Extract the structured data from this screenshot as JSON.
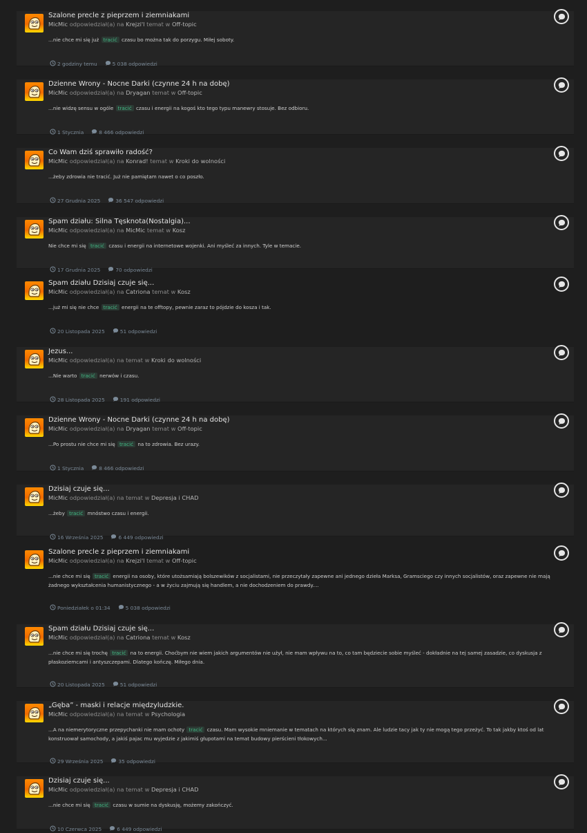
{
  "results": [
    {
      "title": "Szalone precle z pieprzem i ziemniakami",
      "author": "MicMic",
      "action": "odpowiedział(a) na",
      "topic_author": "Krejzi'l",
      "forum": "Off-topic",
      "snippet_before": "...nie chce mi się już",
      "highlight": "tracić",
      "snippet_after": "czasu bo można tak do porzygu. Miłej soboty.",
      "date": "2 godziny temu",
      "replies": "5 038 odpowiedzi"
    },
    {
      "title": "Dzienne Wrony - Nocne Darki (czynne 24 h na dobę)",
      "author": "MicMic",
      "action": "odpowiedział(a) na",
      "topic_author": "Dryagan",
      "forum": "Off-topic",
      "snippet_before": "...nie widzę sensu w ogóle",
      "highlight": "tracić",
      "snippet_after": "czasu i energii na kogoś kto tego typu manewry stosuje. Bez odbioru.",
      "date": "1 Stycznia",
      "replies": "8 466 odpowiedzi"
    },
    {
      "title": "Co Wam dziś sprawiło radość?",
      "author": "MicMic",
      "action": "odpowiedział(a) na",
      "topic_author": "Konrad!",
      "forum": "Kroki do wolności",
      "snippet_before": "...żeby zdrowia nie tracić. Już nie pamiętam nawet o co poszło.",
      "highlight": "",
      "snippet_after": "",
      "date": "27 Grudnia 2025",
      "replies": "36 547 odpowiedzi"
    },
    {
      "title": "Spam działu: Silna Tęsknota(Nostalgia)...",
      "author": "MicMic",
      "action": "odpowiedział(a) na",
      "topic_author": "MicMic",
      "forum": "Kosz",
      "snippet_before": "Nie chce mi się",
      "highlight": "tracić",
      "snippet_after": "czasu i energii na internetowe wojenki. Ani myśleć za innych. Tyle w temacie.",
      "date": "17 Grudnia 2025",
      "replies": "70 odpowiedzi"
    },
    {
      "title": "Spam działu Dzisiaj czuje się...",
      "author": "MicMic",
      "action": "odpowiedział(a) na",
      "topic_author": "Catriona",
      "forum": "Kosz",
      "snippet_before": "...już mi się nie chce",
      "highlight": "tracić",
      "snippet_after": "energii na te offtopy, pewnie zaraz to pójdzie do kosza i tak.",
      "date": "20 Listopada 2025",
      "replies": "51 odpowiedzi"
    },
    {
      "title": "Jezus...",
      "author": "MicMic",
      "action": "odpowiedział(a) na",
      "topic_author": "",
      "forum": "Kroki do wolności",
      "snippet_before": "...Nie warto",
      "highlight": "tracić",
      "snippet_after": "nerwów i czasu.",
      "date": "28 Listopada 2025",
      "replies": "191 odpowiedzi"
    },
    {
      "title": "Dzienne Wrony - Nocne Darki (czynne 24 h na dobę)",
      "author": "MicMic",
      "action": "odpowiedział(a) na",
      "topic_author": "Dryagan",
      "forum": "Off-topic",
      "snippet_before": "...Po prostu nie chce mi się",
      "highlight": "tracić",
      "snippet_after": "na to zdrowia. Bez urazy.",
      "date": "1 Stycznia",
      "replies": "8 466 odpowiedzi"
    },
    {
      "title": "Dzisiaj czuje się...",
      "author": "MicMic",
      "action": "odpowiedział(a) na",
      "topic_author": "",
      "forum": "Depresja i CHAD",
      "snippet_before": "...żeby",
      "highlight": "tracić",
      "snippet_after": "mnóstwo czasu i energii.",
      "date": "16 Września 2025",
      "replies": "6 449 odpowiedzi"
    },
    {
      "title": "Szalone precle z pieprzem i ziemniakami",
      "author": "MicMic",
      "action": "odpowiedział(a) na",
      "topic_author": "Krejzi'l",
      "forum": "Off-topic",
      "snippet_before": "...nie chce mi się",
      "highlight": "tracić",
      "snippet_after": "energii na osoby, które utożsamiają bolszewików z socjalistami, nie przeczytały zapewne ani jednego dzieła Marksa, Gramsciego czy innych socjalistów, oraz zapewne nie mają żadnego wykształcenia humanistycznego - a w życiu zajmują się handlem, a nie dochodzeniem do prawdy....",
      "date": "Poniedziałek o 01:34",
      "replies": "5 038 odpowiedzi"
    },
    {
      "title": "Spam działu Dzisiaj czuje się...",
      "author": "MicMic",
      "action": "odpowiedział(a) na",
      "topic_author": "Catriona",
      "forum": "Kosz",
      "snippet_before": "...nie chce mi się trochę",
      "highlight": "tracić",
      "snippet_after": "na to energii. Choćbym nie wiem jakich argumentów nie użył, nie mam wpływu na to, co tam będziecie sobie myśleć - dokładnie na tej samej zasadzie, co dyskusja z płaskoziemcami i antyszczepami. Dlatego kończę. Miłego dnia.",
      "date": "20 Listopada 2025",
      "replies": "51 odpowiedzi"
    },
    {
      "title": "„Gęba” - maski i relacje międzyludzkie.",
      "author": "MicMic",
      "action": "odpowiedział(a) na",
      "topic_author": "",
      "forum": "Psychologia",
      "snippet_before": "...A na niemerytoryczne przepychanki nie mam ochoty",
      "highlight": "tracić",
      "snippet_after": "czasu. Mam wysokie mniemanie w tematach na których się znam. Ale ludzie tacy jak ty nie mogą tego przeżyć. To tak jakby ktoś od lat konstruował samochody, a jakiś pajac mu wyjedzie z jakimiś głupotami na temat budowy pierścieni tłokowych...",
      "date": "29 Września 2025",
      "replies": "35 odpowiedzi"
    },
    {
      "title": "Dzisiaj czuje się...",
      "author": "MicMic",
      "action": "odpowiedział(a) na",
      "topic_author": "",
      "forum": "Depresja i CHAD",
      "snippet_before": "...nie chce mi się",
      "highlight": "tracić",
      "snippet_after": "czasu w sumie na dyskusję, możemy zakończyć.",
      "date": "10 Czerwca 2025",
      "replies": "6 449 odpowiedzi"
    }
  ],
  "labels": {
    "topic_word": "temat",
    "in_word": "w"
  },
  "colors": {
    "background": "#1e1e1e",
    "card": "#252525",
    "highlight_text": "#41b883",
    "meta": "#7b8a98"
  },
  "icons": {
    "avatar": "avatar",
    "reply": "reply-bubble-icon",
    "clock": "clock-icon",
    "comment": "comment-icon"
  }
}
